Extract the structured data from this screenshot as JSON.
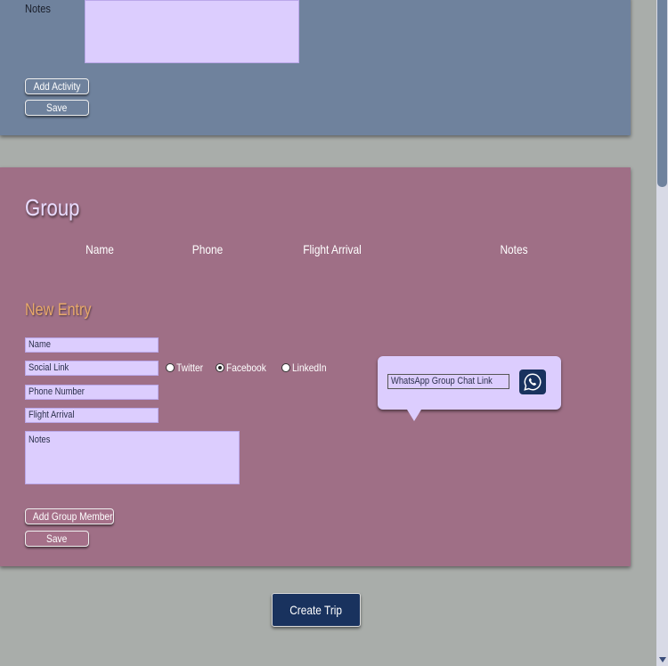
{
  "activity": {
    "notes_label": "Notes",
    "add_activity_label": "Add Activity",
    "save_label": "Save"
  },
  "group": {
    "title": "Group",
    "columns": [
      "Name",
      "Phone",
      "Flight Arrival",
      "Notes"
    ],
    "new_entry_title": "New Entry",
    "fields": {
      "name_placeholder": "Name",
      "social_placeholder": "Social Link",
      "phone_placeholder": "Phone Number",
      "flight_placeholder": "Flight Arrival",
      "notes_placeholder": "Notes"
    },
    "social_options": [
      "Twitter",
      "Facebook",
      "LinkedIn"
    ],
    "selected_social": "Facebook",
    "whatsapp_placeholder": "WhatsApp Group Chat Link",
    "add_member_label": "Add Group Member",
    "save_label": "Save"
  },
  "create_trip_label": "Create Trip",
  "icons": {
    "whatsapp": "whatsapp-icon",
    "scroll_down": "chevron-down-icon"
  },
  "colors": {
    "background": "#a9adaa",
    "activity_panel": "#6f829d",
    "group_panel": "#9f6f86",
    "input_fill": "#dccdfe",
    "primary_button": "#19325e",
    "accent_heading": "#e8a96a"
  }
}
